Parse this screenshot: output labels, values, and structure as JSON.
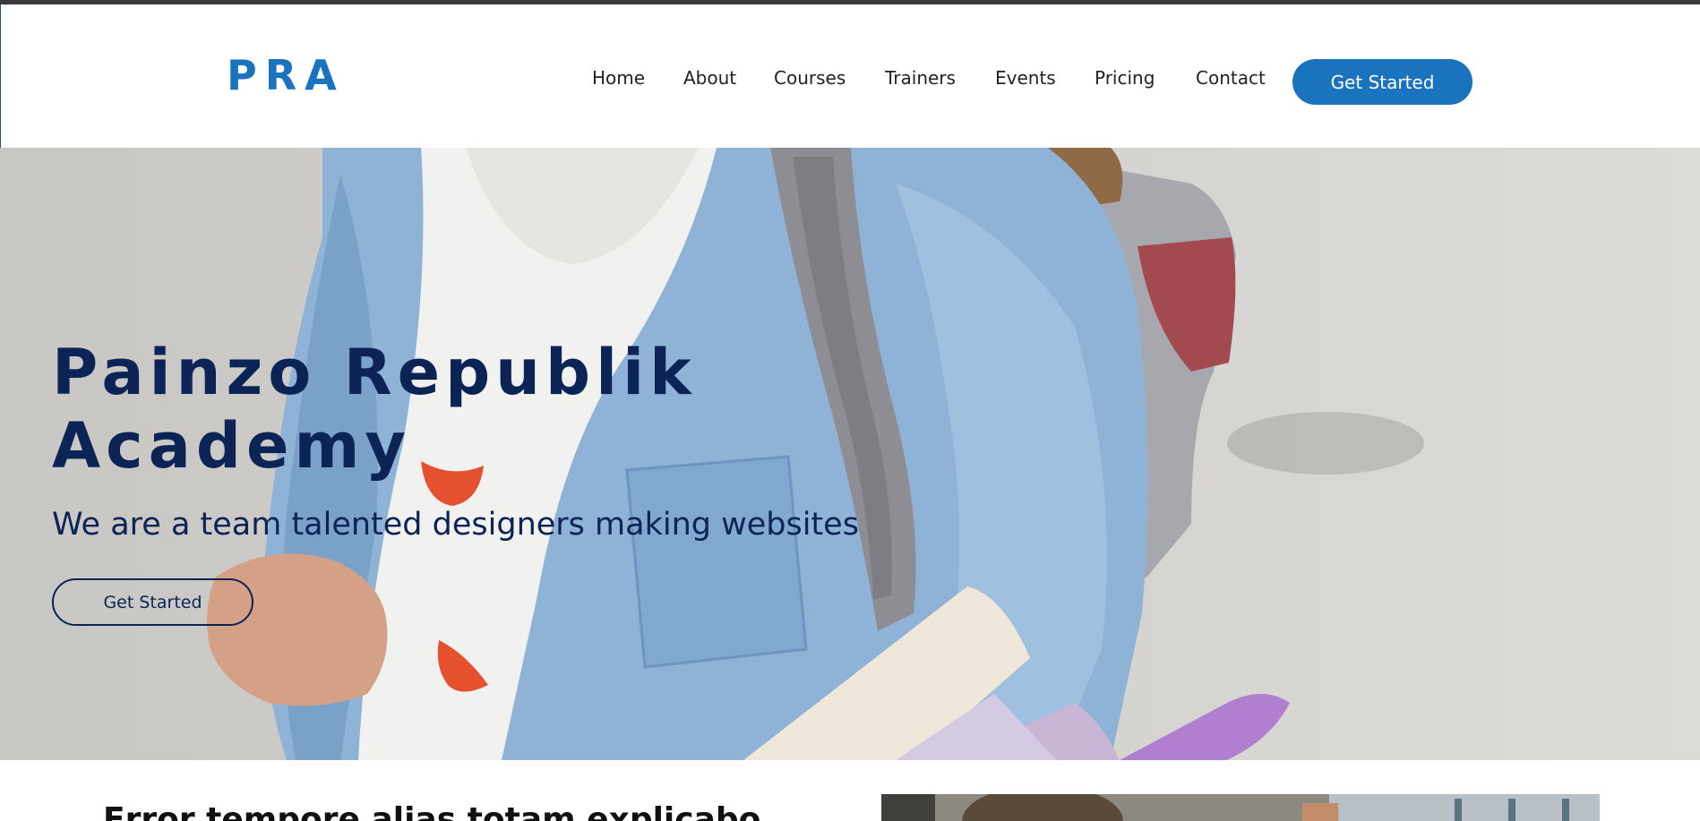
{
  "brand": {
    "logo": "PRA",
    "accent": "#1a73be",
    "heading_color": "#0c2356"
  },
  "nav": {
    "items": [
      {
        "label": "Home",
        "icon": ""
      },
      {
        "label": "About"
      },
      {
        "label": "Courses"
      },
      {
        "label": "Trainers"
      },
      {
        "label": "Events"
      },
      {
        "label": "Pricing"
      },
      {
        "label": "Contact"
      }
    ],
    "cta": "Get Started"
  },
  "hero": {
    "title_line1": "Painzo Republik",
    "title_line2": "Academy",
    "subtitle": "We are a team talented designers making websites",
    "cta": "Get Started",
    "image": "student-denim-jacket-backpack-books-photo"
  },
  "about": {
    "title": "Error tempore alias totam explicabo",
    "image": "students-photo"
  }
}
